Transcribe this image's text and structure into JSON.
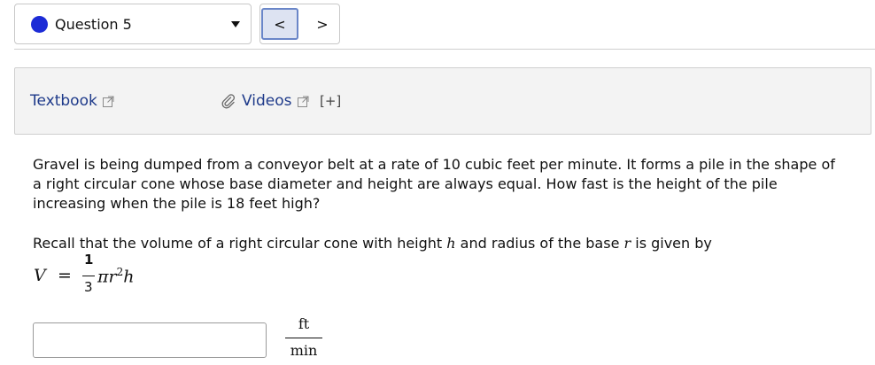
{
  "question_selector": {
    "label": "Question 5",
    "dot_color": "#1c2bd6"
  },
  "nav": {
    "prev": "<",
    "next": ">"
  },
  "resources": {
    "textbook": "Textbook",
    "videos": "Videos",
    "expand": "[+]",
    "link_color": "#1e3a8a"
  },
  "problem": {
    "text": "Gravel is being dumped from a conveyor belt at a rate of 10 cubic feet per minute. It forms a pile in the shape of a right circular cone whose base diameter and height are always equal. How fast is the height of the pile increasing when the pile is 18 feet high?",
    "recall_prefix": "Recall that the volume of a right circular cone with height ",
    "recall_h": "h",
    "recall_mid": " and radius of the base ",
    "recall_r": "r",
    "recall_suffix": " is given by"
  },
  "formula": {
    "lhs": "V",
    "eq": "=",
    "numerator": "1",
    "denominator": "3",
    "pi_r": "πr",
    "exp": "2",
    "h": "h"
  },
  "answer": {
    "value": "",
    "unit_numerator": "ft",
    "unit_denominator": "min"
  }
}
